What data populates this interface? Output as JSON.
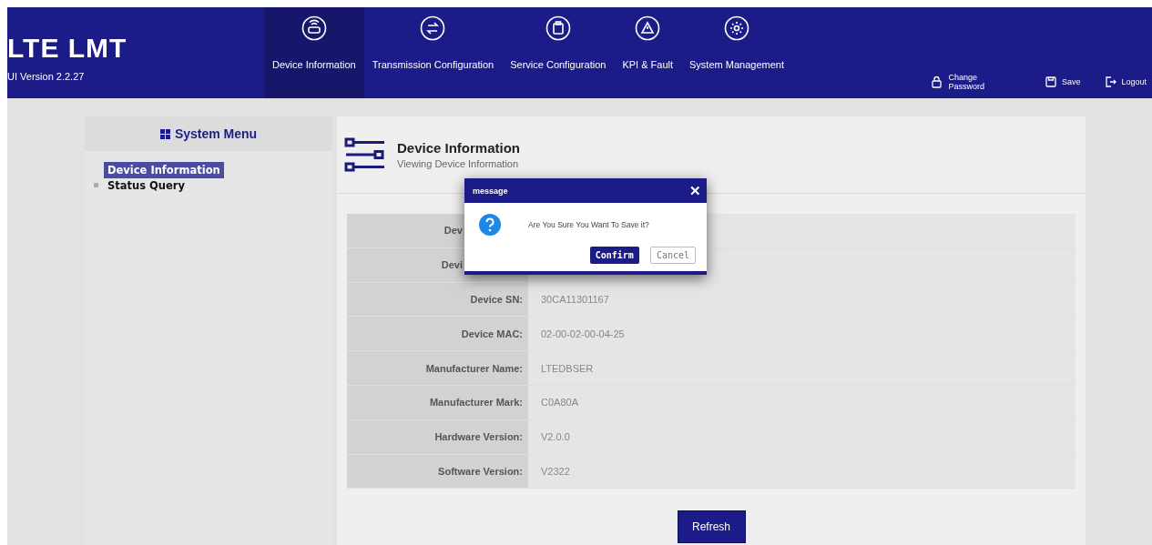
{
  "brand": {
    "title": "LTE LMT",
    "version": "UI Version 2.2.27"
  },
  "nav": [
    {
      "label": "Device Information",
      "selected": true
    },
    {
      "label": "Transmission Configuration",
      "selected": false
    },
    {
      "label": "Service Configuration",
      "selected": false
    },
    {
      "label": "KPI & Fault",
      "selected": false
    },
    {
      "label": "System Management",
      "selected": false
    }
  ],
  "actions": [
    {
      "label": "Change\nPassword"
    },
    {
      "label": "Save"
    },
    {
      "label": "Logout"
    }
  ],
  "sidebar": {
    "title": "System Menu",
    "items": [
      {
        "label": "Device Information",
        "selected": true
      },
      {
        "label": "Status Query",
        "selected": false,
        "expanded": false
      }
    ]
  },
  "page": {
    "title": "Device Information",
    "subtitle": "Viewing Device Information"
  },
  "table": {
    "rows": [
      {
        "label": "Dev"
      },
      {
        "label": "Devi"
      },
      {
        "label": "Device SN:",
        "value": "30CA11301167"
      },
      {
        "label": "Device MAC:",
        "value": "02-00-02-00-04-25"
      },
      {
        "label": "Manufacturer Name:",
        "value": "LTEDBSER"
      },
      {
        "label": "Manufacturer Mark:",
        "value": "C0A80A"
      },
      {
        "label": "Hardware Version:",
        "value": "V2.0.0"
      },
      {
        "label": "Software Version:",
        "value": "V2322"
      }
    ]
  },
  "refresh_button": "Refresh",
  "dialog": {
    "title": "message",
    "close": "✕",
    "message": "Are You Sure You Want To Save it?",
    "confirm": "Confirm",
    "cancel": "Cancel"
  }
}
